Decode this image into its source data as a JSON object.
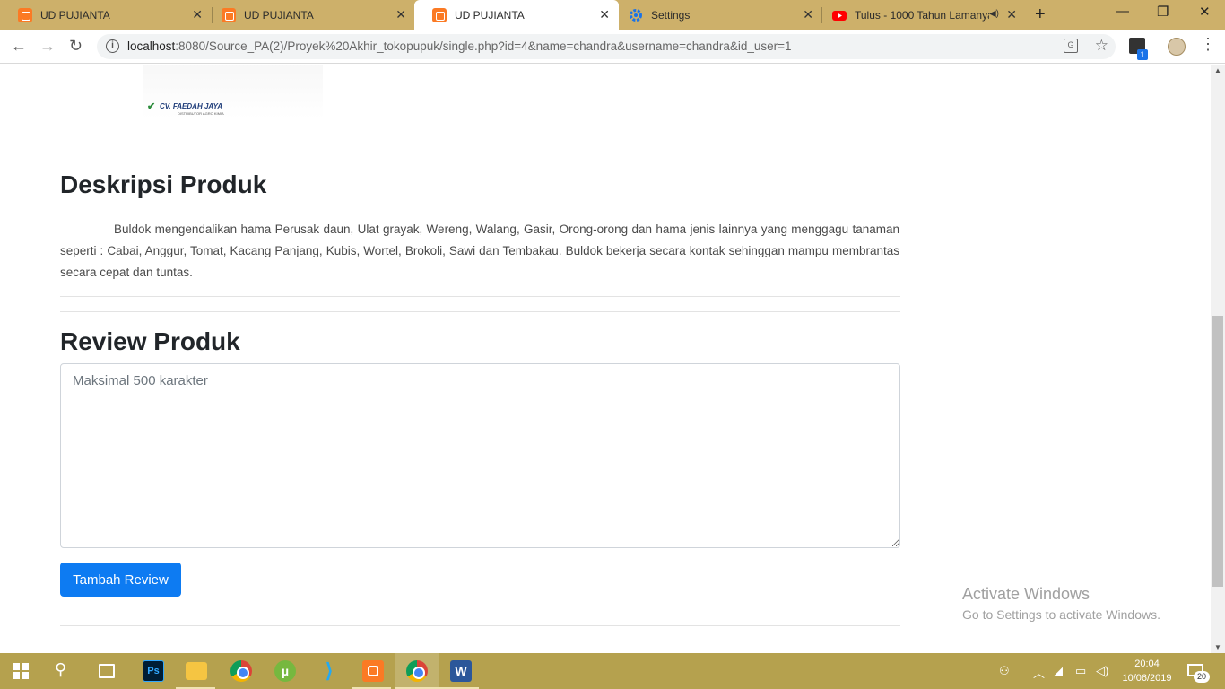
{
  "browser": {
    "tabs": [
      {
        "label": "UD PUJIANTA",
        "icon": "xampp-icon",
        "active": false
      },
      {
        "label": "UD PUJIANTA",
        "icon": "xampp-icon",
        "active": false
      },
      {
        "label": "UD PUJIANTA",
        "icon": "xampp-icon",
        "active": true
      },
      {
        "label": "Settings",
        "icon": "gear-icon",
        "active": false
      },
      {
        "label": "Tulus - 1000 Tahun Lamanya",
        "icon": "youtube-icon",
        "active": false
      }
    ],
    "close_glyph": "✕",
    "new_tab_glyph": "+",
    "url_host": "localhost",
    "url_path": ":8080/Source_PA(2)/Proyek%20Akhir_tokopupuk/single.php?id=4&name=chandra&username=chandra&id_user=1",
    "extension_badge": "1"
  },
  "product": {
    "logo_text": "CV. FAEDAH JAYA",
    "logo_subtext": "DISTRIBUTOR AGRO KIMIA"
  },
  "description": {
    "heading": "Deskripsi Produk",
    "text": "Buldok mengendalikan hama Perusak daun, Ulat grayak, Wereng, Walang, Gasir, Orong-orong dan hama jenis lainnya yang menggagu tanaman seperti : Cabai, Anggur, Tomat, Kacang Panjang, Kubis, Wortel, Brokoli, Sawi dan Tembakau. Buldok bekerja secara kontak sehinggan mampu membrantas secara cepat dan tuntas."
  },
  "review": {
    "heading": "Review Produk",
    "placeholder": "Maksimal 500 karakter",
    "value": "",
    "submit_label": "Tambah Review"
  },
  "watermark": {
    "title": "Activate Windows",
    "subtitle": "Go to Settings to activate Windows."
  },
  "taskbar": {
    "time": "20:04",
    "date": "10/06/2019",
    "notification_count": "20"
  },
  "colors": {
    "tabstrip": "#cdb06a",
    "taskbar": "#b5a14e",
    "primary_button": "#0d7bf2"
  }
}
